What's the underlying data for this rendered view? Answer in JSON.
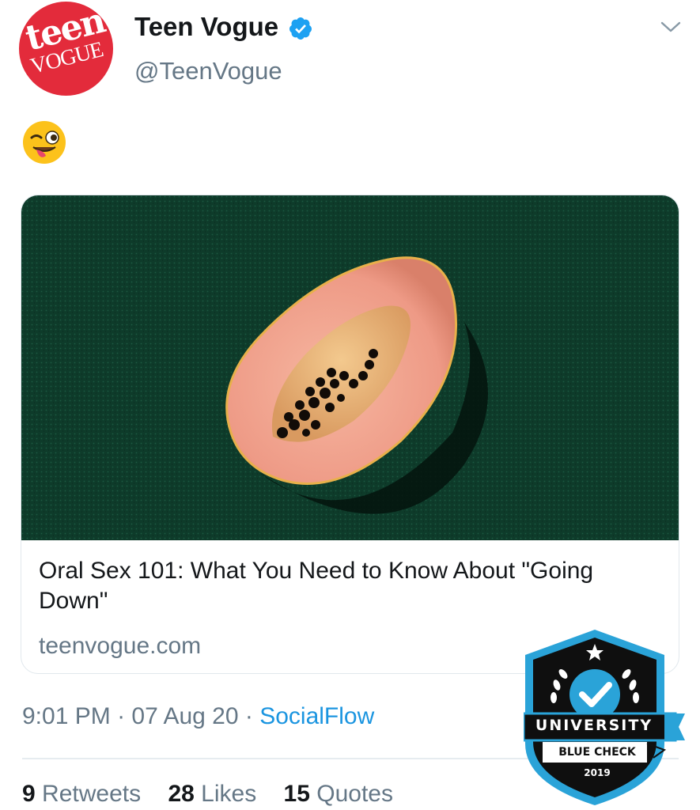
{
  "tweet": {
    "author": {
      "display_name": "Teen Vogue",
      "handle": "@TeenVogue",
      "verified": true,
      "avatar_logo": {
        "word": "teen",
        "sub": "VOGUE"
      }
    },
    "text_emoji": "winking-face-with-tongue",
    "card": {
      "title": "Oral Sex 101: What You Need to Know About \"Going Down\"",
      "domain": "teenvogue.com",
      "image_alt": "papaya-half-on-green-background"
    },
    "meta": {
      "time": "9:01 PM",
      "separator": " · ",
      "date": "07 Aug 20",
      "source": "SocialFlow"
    },
    "stats": {
      "retweets_count": "9",
      "retweets_label": "Retweets",
      "likes_count": "28",
      "likes_label": "Likes",
      "quotes_count": "15",
      "quotes_label": "Quotes"
    }
  },
  "watermark": {
    "main": "UNIVERSITY",
    "sub": "BLUE CHECK",
    "year": "2019"
  },
  "colors": {
    "text_primary": "#14171a",
    "text_secondary": "#657786",
    "link": "#1b95e0",
    "verified": "#1da1f2",
    "avatar_bg": "#e32b3b",
    "card_bg": "#0f3d2c"
  }
}
